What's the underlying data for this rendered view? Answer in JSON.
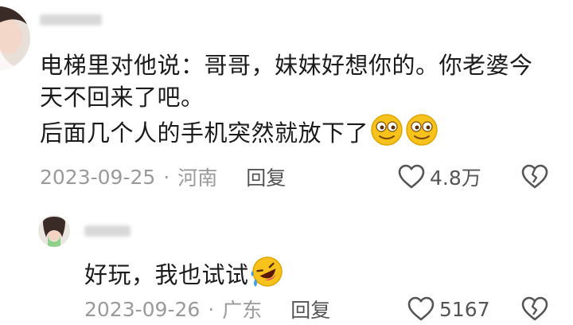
{
  "comments": [
    {
      "lines": [
        "电梯里对他说：哥哥，妹妹好想你的。你老婆今",
        "天不回来了吧。",
        "后面几个人的手机突然就放下了"
      ],
      "emojis": [
        "smirk-emoji",
        "smirk-emoji"
      ],
      "date": "2023-09-25",
      "location": "河南",
      "reply_label": "回复",
      "likes": "4.8万",
      "like_icon": "heart-icon",
      "dislike_icon": "broken-heart-icon"
    },
    {
      "lines": [
        "好玩，我也试试"
      ],
      "emojis": [
        "rolling-laugh-emoji"
      ],
      "date": "2023-09-26",
      "location": "广东",
      "reply_label": "回复",
      "likes": "5167",
      "like_icon": "heart-icon",
      "dislike_icon": "broken-heart-icon"
    }
  ],
  "meta_separator": "·",
  "colors": {
    "text": "#1b1b1b",
    "meta": "#9a9a9a",
    "icon": "#555555",
    "emoji_face": "#f7c21c"
  }
}
